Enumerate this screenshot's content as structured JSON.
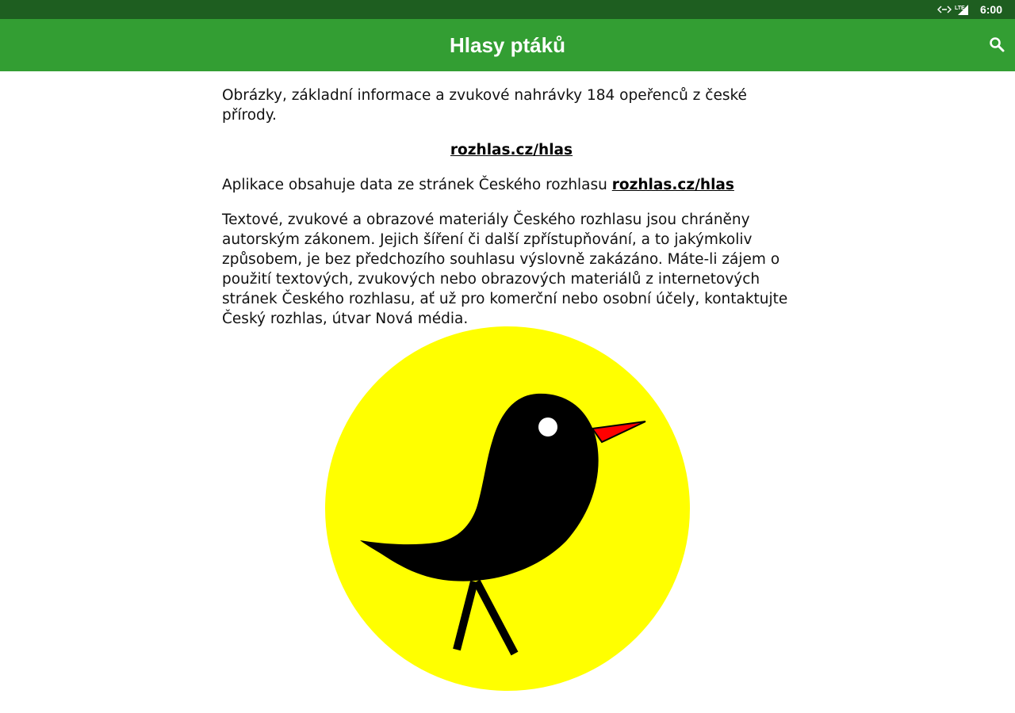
{
  "status_bar": {
    "network_label": "LTE",
    "time": "6:00"
  },
  "app_bar": {
    "title": "Hlasy ptáků",
    "search_icon": "search-icon"
  },
  "content": {
    "intro": "Obrázky, základní informace a zvukové nahrávky 184 opeřenců z české přírody.",
    "link_centered": "rozhlas.cz/hlas",
    "source_prefix": "Aplikace obsahuje data ze stránek Českého rozhlasu ",
    "source_link": "rozhlas.cz/hlas",
    "copyright": "Textové, zvukové a obrazové materiály Českého rozhlasu jsou chráněny autorským zákonem. Jejich šíření či další zpřístupňování, a to jakýmkoliv způsobem, je bez předchozího souhlasu výslovně zakázáno. Máte-li zájem o použití textových, zvukových nebo obrazových materiálů z internetových stránek Českého rozhlasu, ať už pro komerční nebo osobní účely, kontaktujte Český rozhlas, útvar Nová média."
  },
  "logo": {
    "icon": "bird-logo-icon",
    "circle_color": "#ffff00",
    "bird_color": "#000000",
    "beak_color": "#ff0000",
    "eye_color": "#ffffff"
  },
  "colors": {
    "status_bar": "#1e5e20",
    "app_bar": "#339e33"
  }
}
